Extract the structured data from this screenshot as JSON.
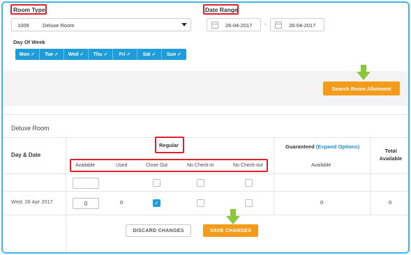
{
  "filters": {
    "room_type_label": "Room Type",
    "room_type_code": "1009",
    "room_type_value": ".Deluxe Room",
    "date_range_label": "Date Range",
    "date_from": "26-04-2017",
    "date_separator": "-",
    "date_to": "26-04-2017",
    "day_of_week_label": "Day Of Week",
    "days": [
      {
        "label": "Mon",
        "checked": true
      },
      {
        "label": "Tue",
        "checked": true
      },
      {
        "label": "Wed",
        "checked": true
      },
      {
        "label": "Thu",
        "checked": true
      },
      {
        "label": "Fri",
        "checked": true
      },
      {
        "label": "Sat",
        "checked": true
      },
      {
        "label": "Sun",
        "checked": true
      }
    ],
    "search_button": "Search Room Allotment"
  },
  "allotment": {
    "section_title": "Deluxe Room",
    "col_day_date": "Day & Date",
    "col_regular": "Regular",
    "col_guaranteed": "Guaranteed",
    "guaranteed_link": "(Expand Options)",
    "col_total_available": "Total Available",
    "regular_sub": [
      "Available",
      "Used",
      "Close Out",
      "No Check-in",
      "No Check-out"
    ],
    "guaranteed_sub": "Available",
    "row": {
      "date": "Wed, 26 Apr 2017",
      "available": "0",
      "used": "0",
      "close_out": true,
      "no_check_in": false,
      "no_check_out": false,
      "guaranteed_available": "0",
      "total_available": "0"
    },
    "discard_button": "DISCARD CHANGES",
    "save_button": "SAVE CHANGES"
  },
  "colors": {
    "accent_blue": "#1f9ddb",
    "accent_orange": "#f39c1c",
    "highlight_red": "#e0202a",
    "arrow_green": "#8cc63f"
  }
}
